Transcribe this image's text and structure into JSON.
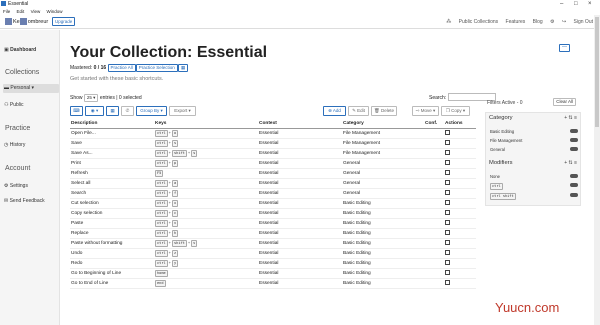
{
  "window": {
    "title": "Essential"
  },
  "menu": [
    "File",
    "Edit",
    "View",
    "Window"
  ],
  "topnav": {
    "logo": "Ke",
    "logo2": "ombreur",
    "upgrade": "Upgrade",
    "links": [
      "Public Collections",
      "Features",
      "Blog",
      "Sign Out"
    ]
  },
  "sidebar": {
    "dashboard": "Dashboard",
    "collections": "Collections",
    "personal": "Personal",
    "public": "Public",
    "practice": "Practice",
    "history": "History",
    "account": "Account",
    "settings": "Settings",
    "feedback": "Send Feedback"
  },
  "main": {
    "title": "Your Collection: Essential",
    "mastered_label": "Mastered:",
    "mastered_value": "0 / 16",
    "practice_all": "Practice All",
    "practice_selection": "Practice Selection",
    "subtitle": "Get started with these basic shortcuts.",
    "show_label": "Show",
    "show_value": "25",
    "entries_label": "entries | 0 selected",
    "search_label": "Search:"
  },
  "toolbar": {
    "groupby": "Group By",
    "export": "Export",
    "add": "Add",
    "edit": "Edit",
    "delete": "Delete",
    "move": "Move",
    "copy": "Copy"
  },
  "table": {
    "headers": [
      "Description",
      "Keys",
      "Context",
      "Category",
      "Conf.",
      "Actions"
    ],
    "rows": [
      {
        "desc": "Open File...",
        "keys": [
          "ctrl",
          "o"
        ],
        "context": "Essential",
        "category": "File Management"
      },
      {
        "desc": "Save",
        "keys": [
          "ctrl",
          "s"
        ],
        "context": "Essential",
        "category": "File Management"
      },
      {
        "desc": "Save As...",
        "keys": [
          "ctrl",
          "shift",
          "s"
        ],
        "context": "Essential",
        "category": "File Management"
      },
      {
        "desc": "Print",
        "keys": [
          "ctrl",
          "p"
        ],
        "context": "Essential",
        "category": "General"
      },
      {
        "desc": "Refresh",
        "keys": [
          "F5"
        ],
        "context": "Essential",
        "category": "General"
      },
      {
        "desc": "Select all",
        "keys": [
          "ctrl",
          "a"
        ],
        "context": "Essential",
        "category": "General"
      },
      {
        "desc": "Search",
        "keys": [
          "ctrl",
          "f"
        ],
        "context": "Essential",
        "category": "General"
      },
      {
        "desc": "Cut selection",
        "keys": [
          "ctrl",
          "x"
        ],
        "context": "Essential",
        "category": "Basic Editing"
      },
      {
        "desc": "Copy selection",
        "keys": [
          "ctrl",
          "c"
        ],
        "context": "Essential",
        "category": "Basic Editing"
      },
      {
        "desc": "Paste",
        "keys": [
          "ctrl",
          "v"
        ],
        "context": "Essential",
        "category": "Basic Editing"
      },
      {
        "desc": "Replace",
        "keys": [
          "ctrl",
          "h"
        ],
        "context": "Essential",
        "category": "Basic Editing"
      },
      {
        "desc": "Paste without formatting",
        "keys": [
          "ctrl",
          "shift",
          "v"
        ],
        "context": "Essential",
        "category": "Basic Editing"
      },
      {
        "desc": "Undo",
        "keys": [
          "ctrl",
          "z"
        ],
        "context": "Essential",
        "category": "Basic Editing"
      },
      {
        "desc": "Redo",
        "keys": [
          "ctrl",
          "y"
        ],
        "context": "Essential",
        "category": "Basic Editing"
      },
      {
        "desc": "Go to Beginning of Line",
        "keys": [
          "home"
        ],
        "context": "Essential",
        "category": "Basic Editing"
      },
      {
        "desc": "Go to End of Line",
        "keys": [
          "end"
        ],
        "context": "Essential",
        "category": "Basic Editing"
      }
    ]
  },
  "filters": {
    "active_label": "Filters Active - 0",
    "clear_all": "Clear All",
    "category_title": "Category",
    "categories": [
      "Basic Editing",
      "File Management",
      "General"
    ],
    "modifiers_title": "Modifiers",
    "modifiers": [
      "None",
      "ctrl",
      "ctrl shift"
    ]
  },
  "watermark": "Yuucn.com"
}
